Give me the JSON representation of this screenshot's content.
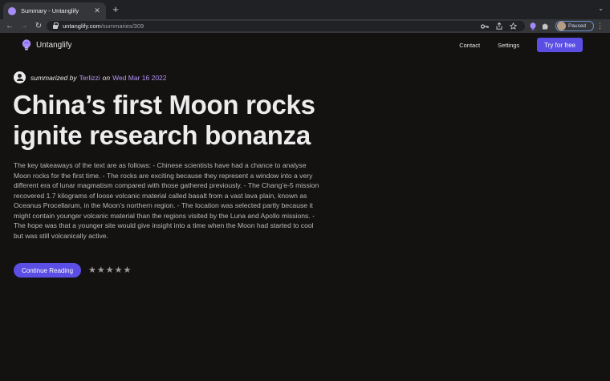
{
  "browser": {
    "tab_title": "Summary - Untanglify",
    "tab_close": "✕",
    "new_tab": "+",
    "tab_menu": "⌄",
    "url_host": "untanglify.com",
    "url_path": "/summaries/309",
    "profile_status": "Paused",
    "nav": {
      "back": "←",
      "forward": "→",
      "reload": "↻"
    },
    "icons": [
      "key-icon",
      "share-icon",
      "star-icon",
      "extension-icon",
      "puzzle-icon",
      "kebab-icon"
    ]
  },
  "site": {
    "brand": "Untanglify",
    "brand_color": "#a78bfa",
    "nav_links": [
      "Contact",
      "Settings"
    ],
    "cta_label": "Try for free",
    "accent_color": "#5b4ee4"
  },
  "article": {
    "byline_prefix": "summarized by",
    "author": "Terlizzi",
    "byline_on": "on",
    "date": "Wed Mar 16 2022",
    "title": "China’s first Moon rocks ignite research bonanza",
    "summary": "The key takeaways of the text are as follows: - Chinese scientists have had a chance to analyse Moon rocks for the first time. - The rocks are exciting because they represent a window into a very different era of lunar magmatism compared with those gathered previously. - The Chang’e-5 mission recovered 1.7 kilograms of loose volcanic material called basalt from a vast lava plain, known as Oceanus Procellarum, in the Moon’s northern region. - The location was selected partly because it might contain younger volcanic material than the regions visited by the Luna and Apollo missions. - The hope was that a younger site would give insight into a time when the Moon had started to cool but was still volcanically active.",
    "continue_label": "Continue Reading",
    "rating_stars": "★★★★★"
  }
}
